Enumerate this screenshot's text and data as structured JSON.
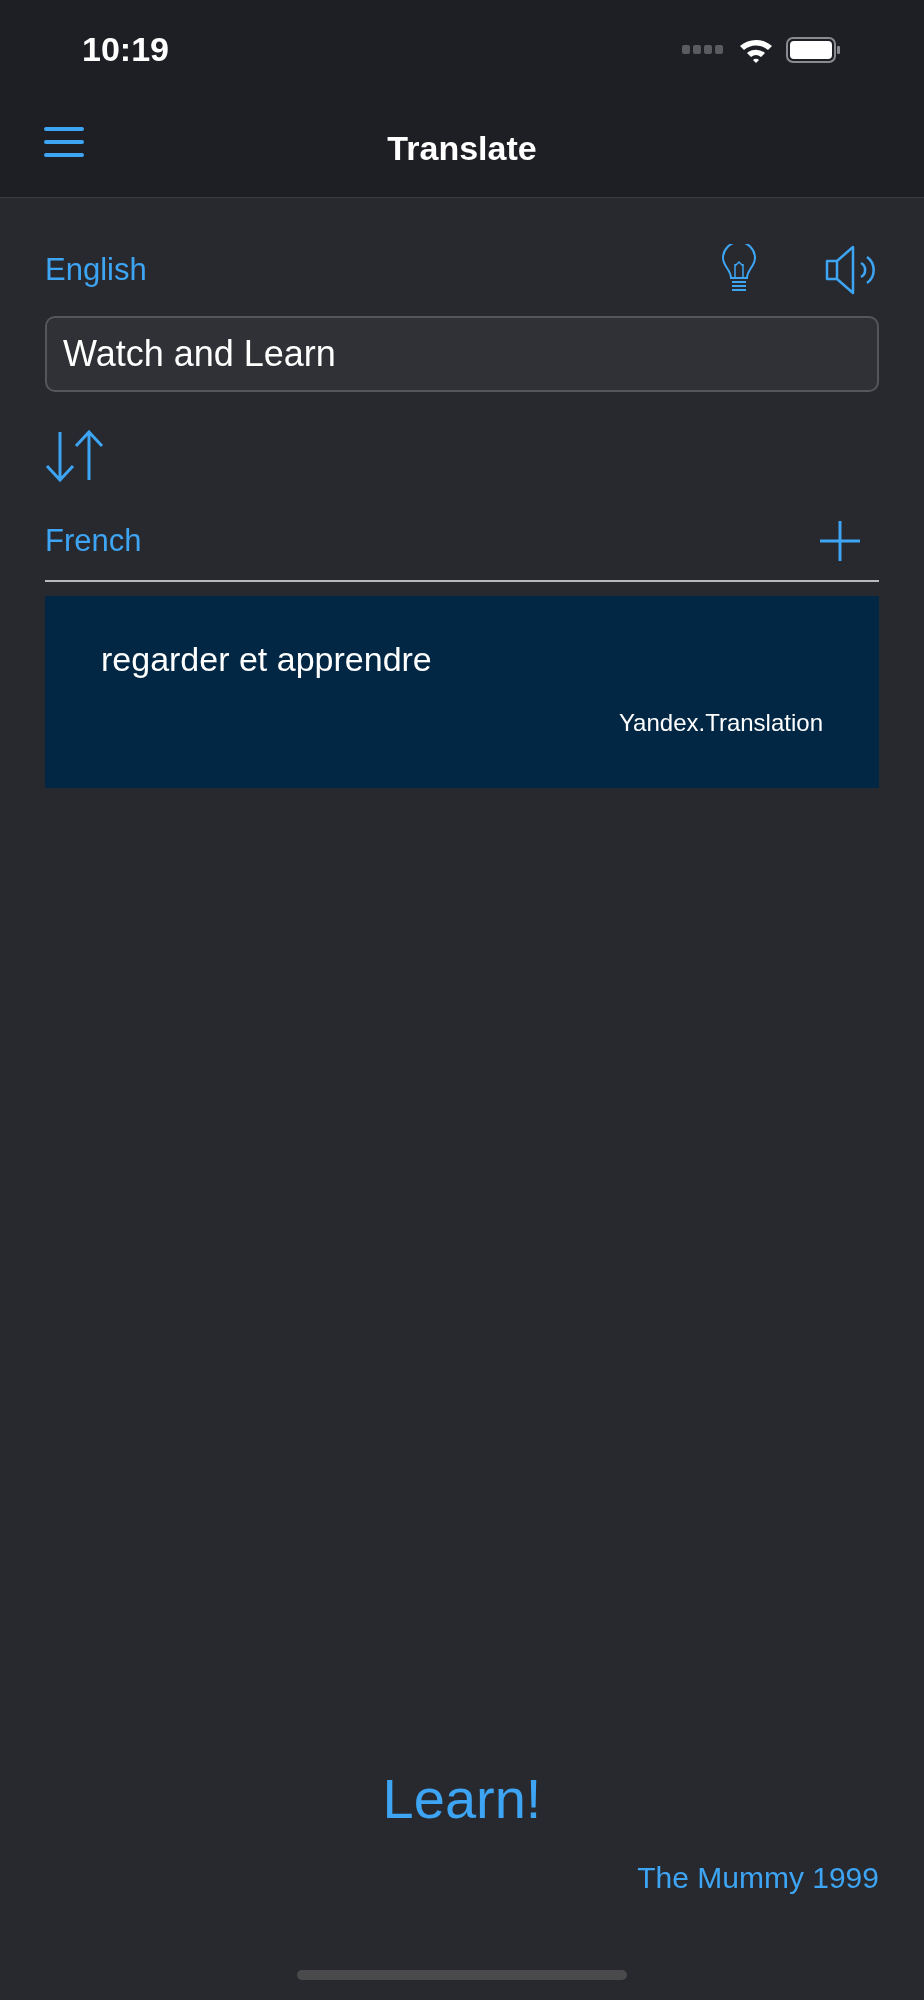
{
  "status_bar": {
    "time": "10:19"
  },
  "nav": {
    "title": "Translate"
  },
  "source": {
    "language": "English",
    "text": "Watch and Learn"
  },
  "target": {
    "language": "French"
  },
  "result": {
    "text": "regarder et apprendre",
    "provider": "Yandex.Translation"
  },
  "learn_button": "Learn!",
  "quote_source": "The Mummy 1999"
}
